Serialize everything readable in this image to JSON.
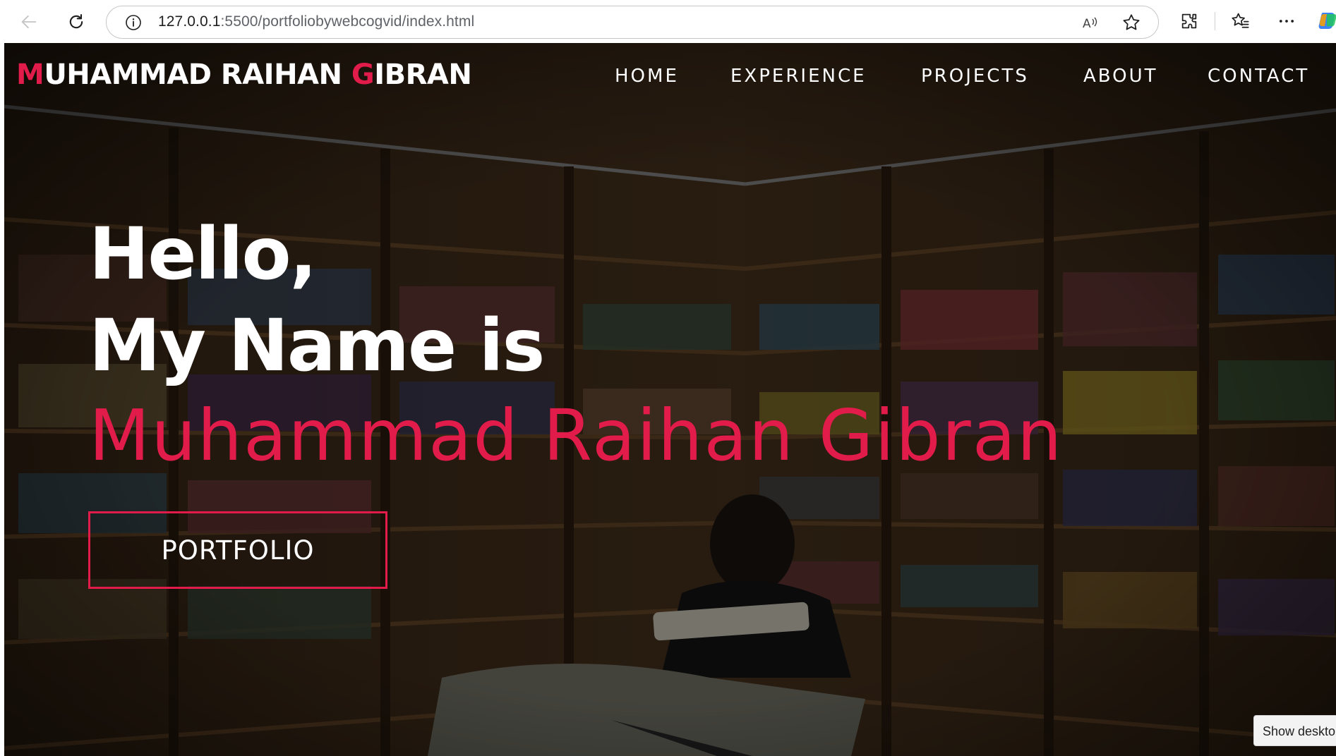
{
  "browser": {
    "url_host": "127.0.0.1",
    "url_path": ":5500/portfoliobywebcogvid/index.html",
    "icons": [
      "back-icon",
      "reload-icon",
      "info-icon",
      "read-aloud-icon",
      "star-icon",
      "extensions-icon",
      "favorites-icon",
      "more-icon",
      "copilot-icon"
    ]
  },
  "site": {
    "logo": {
      "first_initial": "M",
      "first_rest": "UHAMMAD RAIHAN ",
      "last_initial": "G",
      "last_rest": "IBRAN"
    },
    "nav": [
      "HOME",
      "EXPERIENCE",
      "PROJECTS",
      "ABOUT",
      "CONTACT"
    ]
  },
  "hero": {
    "greeting": "Hello,",
    "intro": "My Name is",
    "name": "Muhammad Raihan Gibran",
    "button_label": "PORTFOLIO"
  },
  "taskbar": {
    "show_desktop": "Show desktop"
  },
  "colors": {
    "accent": "#e21c4a",
    "text": "#ffffff"
  }
}
